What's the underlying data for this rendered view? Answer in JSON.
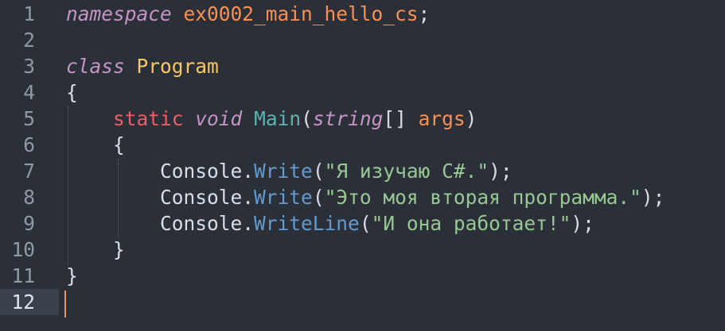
{
  "editor": {
    "language": "C#",
    "theme_colors": {
      "background": "#2a2f38",
      "keyword": "#c594c5",
      "storage": "#ec5f67",
      "string": "#99c794",
      "function": "#6699cc",
      "class": "#fac863",
      "parameter": "#f99157"
    },
    "cursor_line": 12,
    "lines": [
      {
        "n": "1",
        "tokens": [
          [
            "namespace",
            "kw-it"
          ],
          [
            " ",
            "plain"
          ],
          [
            "ex0002_main_hello_cs",
            "ns"
          ],
          [
            ";",
            "punc"
          ]
        ]
      },
      {
        "n": "2",
        "tokens": []
      },
      {
        "n": "3",
        "tokens": [
          [
            "class",
            "kw-it"
          ],
          [
            " ",
            "plain"
          ],
          [
            "Program",
            "cls"
          ]
        ]
      },
      {
        "n": "4",
        "tokens": [
          [
            "{",
            "punc"
          ]
        ]
      },
      {
        "n": "5",
        "tokens": [
          [
            "    ",
            "plain"
          ],
          [
            "static",
            "kw"
          ],
          [
            " ",
            "plain"
          ],
          [
            "void",
            "type-it"
          ],
          [
            " ",
            "plain"
          ],
          [
            "Main",
            "fn2"
          ],
          [
            "(",
            "punc"
          ],
          [
            "string",
            "type-it"
          ],
          [
            "[] ",
            "punc"
          ],
          [
            "args",
            "param"
          ],
          [
            ")",
            "punc"
          ]
        ]
      },
      {
        "n": "6",
        "tokens": [
          [
            "    ",
            "plain"
          ],
          [
            "{",
            "punc"
          ]
        ]
      },
      {
        "n": "7",
        "tokens": [
          [
            "        ",
            "plain"
          ],
          [
            "Console",
            "plain"
          ],
          [
            ".",
            "punc"
          ],
          [
            "Write",
            "fn"
          ],
          [
            "(",
            "punc"
          ],
          [
            "\"Я изучаю C#.\"",
            "str"
          ],
          [
            ");",
            "punc"
          ]
        ]
      },
      {
        "n": "8",
        "tokens": [
          [
            "        ",
            "plain"
          ],
          [
            "Console",
            "plain"
          ],
          [
            ".",
            "punc"
          ],
          [
            "Write",
            "fn"
          ],
          [
            "(",
            "punc"
          ],
          [
            "\"Это моя вторая программа.\"",
            "str"
          ],
          [
            ");",
            "punc"
          ]
        ]
      },
      {
        "n": "9",
        "tokens": [
          [
            "        ",
            "plain"
          ],
          [
            "Console",
            "plain"
          ],
          [
            ".",
            "punc"
          ],
          [
            "WriteLine",
            "fn"
          ],
          [
            "(",
            "punc"
          ],
          [
            "\"И она работает!\"",
            "str"
          ],
          [
            ");",
            "punc"
          ]
        ]
      },
      {
        "n": "10",
        "tokens": [
          [
            "    ",
            "plain"
          ],
          [
            "}",
            "punc"
          ]
        ]
      },
      {
        "n": "11",
        "tokens": [
          [
            "}",
            "punc"
          ]
        ]
      },
      {
        "n": "12",
        "tokens": []
      }
    ]
  }
}
